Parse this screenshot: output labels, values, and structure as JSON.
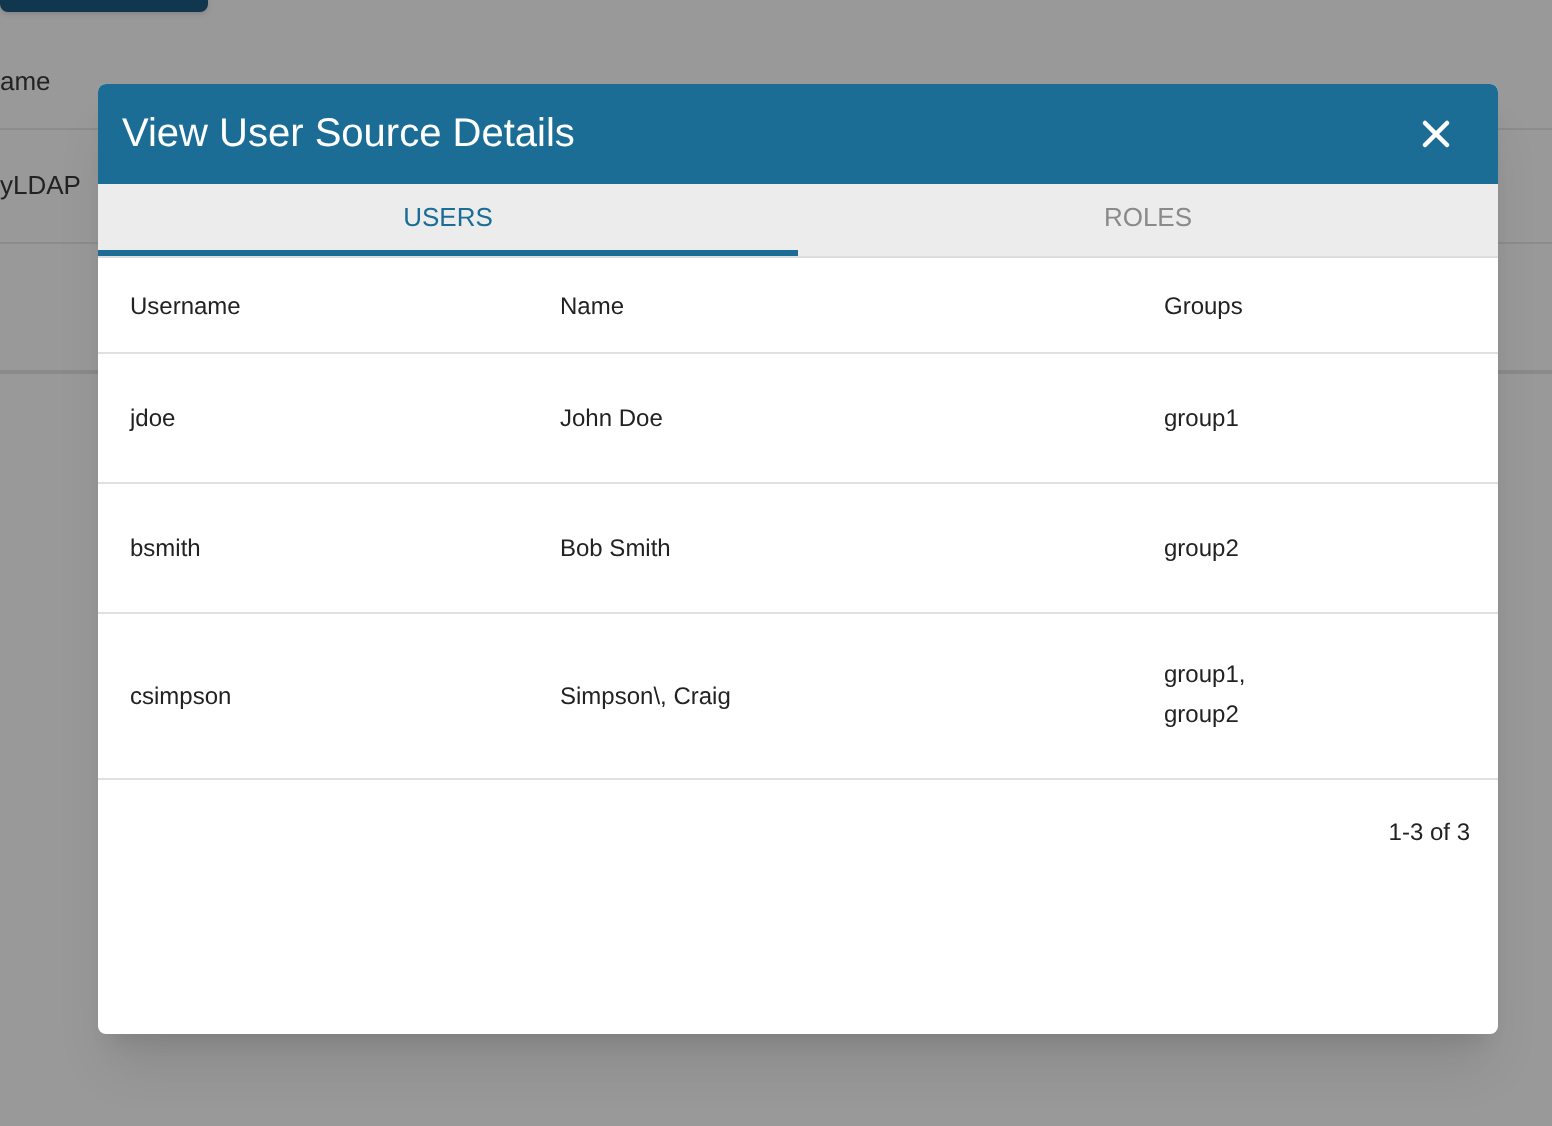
{
  "background": {
    "columns": [
      "ame"
    ],
    "rows": [
      [
        "yLDAP"
      ]
    ]
  },
  "dialog": {
    "title": "View User Source Details",
    "tabs": [
      {
        "label": "USERS",
        "selected": true
      },
      {
        "label": "ROLES",
        "selected": false
      }
    ],
    "table": {
      "columns": [
        "Username",
        "Name",
        "Groups"
      ],
      "rows": [
        [
          "jdoe",
          "John Doe",
          "group1"
        ],
        [
          "bsmith",
          "Bob Smith",
          "group2"
        ],
        [
          "csimpson",
          "Simpson\\, Craig",
          "group1, group2"
        ]
      ]
    },
    "pagination": "1-3 of 3"
  }
}
